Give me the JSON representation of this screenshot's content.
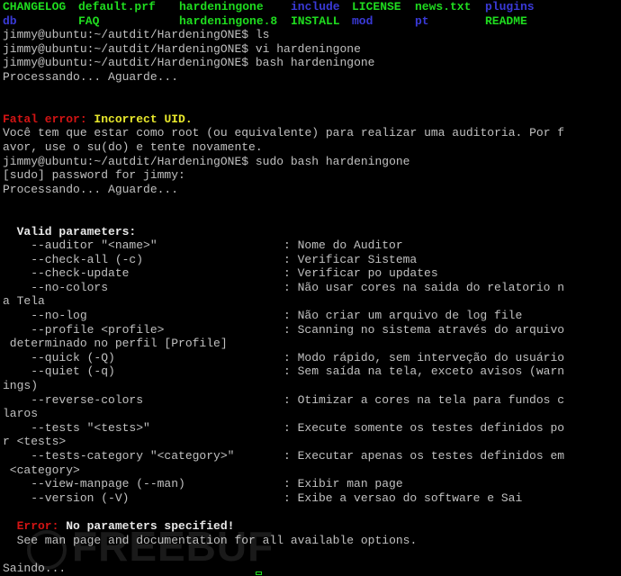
{
  "colors": {
    "background": "#000000",
    "text": "#c0c0c0",
    "green": "#1fdc1f",
    "blue": "#3a3ad8",
    "red": "#d21414",
    "yellow": "#e8e82c"
  },
  "ls_row1": [
    "CHANGELOG",
    "default.prf",
    "hardeningone",
    "include",
    "LICENSE",
    "news.txt",
    "plugins"
  ],
  "ls_row2": [
    "db",
    "FAQ",
    "hardeningone.8",
    "INSTALL",
    "mod",
    "pt",
    "README"
  ],
  "lines": {
    "cmd_ls": "jimmy@ubuntu:~/autdit/HardeningONE$ ls",
    "cmd_vi": "jimmy@ubuntu:~/autdit/HardeningONE$ vi hardeningone",
    "cmd_bash": "jimmy@ubuntu:~/autdit/HardeningONE$ bash hardeningone",
    "processing1": "Processando... Aguarde...",
    "fatal_label": "Fatal error:",
    "fatal_msg": " Incorrect UID.",
    "root_msg1": "Você tem que estar como root (ou equivalente) para realizar uma auditoria. Por f",
    "root_msg2": "avor, use o su(do) e tente novamente.",
    "cmd_sudo": "jimmy@ubuntu:~/autdit/HardeningONE$ sudo bash hardeningone",
    "sudo_prompt": "[sudo] password for jimmy:",
    "processing2": "Processando... Aguarde...",
    "valid_params": "  Valid parameters:",
    "error_label": "Error:",
    "error_msg": " No parameters specified!",
    "see_man": "  See man page and documentation for all available options.",
    "exiting": "Saindo..."
  },
  "params": [
    {
      "opt": "    --auditor \"<name>\"",
      "desc": ": Nome do Auditor",
      "cont": ""
    },
    {
      "opt": "    --check-all (-c)",
      "desc": ": Verificar Sistema",
      "cont": ""
    },
    {
      "opt": "    --check-update",
      "desc": ": Verificar po updates",
      "cont": ""
    },
    {
      "opt": "    --no-colors",
      "desc": ": Não usar cores na saida do relatorio n",
      "cont": "a Tela"
    },
    {
      "opt": "    --no-log",
      "desc": ": Não criar um arquivo de log file",
      "cont": ""
    },
    {
      "opt": "    --profile <profile>",
      "desc": ": Scanning no sistema através do arquivo",
      "cont": " determinado no perfil [Profile]"
    },
    {
      "opt": "    --quick (-Q)",
      "desc": ": Modo rápido, sem interveção do usuário",
      "cont": ""
    },
    {
      "opt": "    --quiet (-q)",
      "desc": ": Sem saída na tela, exceto avisos (warn",
      "cont": "ings)"
    },
    {
      "opt": "    --reverse-colors",
      "desc": ": Otimizar a cores na tela para fundos c",
      "cont": "laros"
    },
    {
      "opt": "    --tests \"<tests>\"",
      "desc": ": Execute somente os testes definidos po",
      "cont": "r <tests>"
    },
    {
      "opt": "    --tests-category \"<category>\"",
      "desc": ": Executar apenas os testes definidos em",
      "cont": " <category>"
    },
    {
      "opt": "    --view-manpage (--man)",
      "desc": ": Exibir man page",
      "cont": ""
    },
    {
      "opt": "    --version (-V)",
      "desc": ": Exibe a versao do software e Sai",
      "cont": ""
    }
  ],
  "watermark": "FREEBUF",
  "icons": {
    "cursor": "cursor-block",
    "watermark": "freebuf-logo-icon"
  }
}
